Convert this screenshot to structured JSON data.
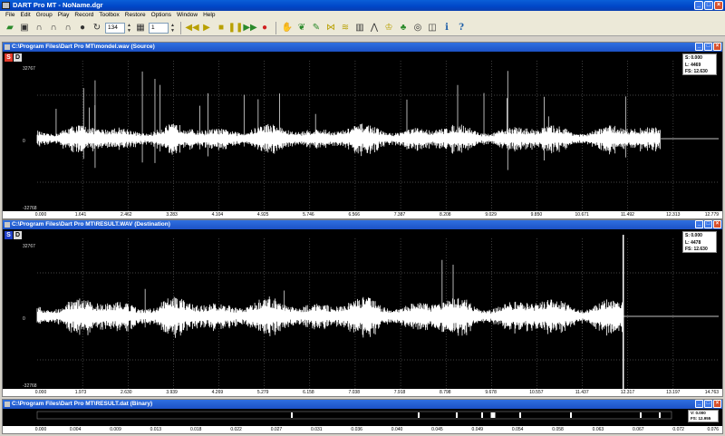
{
  "window": {
    "title": "DART Pro MT - NoName.dgr",
    "controls": [
      "_",
      "□",
      "×"
    ]
  },
  "menu": [
    "File",
    "Edit",
    "Group",
    "Play",
    "Record",
    "Toolbox",
    "Restore",
    "Options",
    "Window",
    "Help"
  ],
  "toolbar": {
    "spin1_value": "134",
    "spin2_value": "1"
  },
  "panels": [
    {
      "title": "C:\\Program Files\\Dart Pro MT\\mondel.wav (Source)",
      "buttons": [
        "S",
        "D"
      ],
      "y_top": "32767",
      "y_mid": "0",
      "y_bottom": "-32768",
      "info": [
        "S: 0.000",
        "L: 4469",
        "FS: 12.630"
      ],
      "x_ticks": [
        "0.000",
        "1.641",
        "2.462",
        "3.283",
        "4.104",
        "4.925",
        "5.746",
        "6.566",
        "7.387",
        "8.208",
        "9.029",
        "9.850",
        "10.671",
        "11.492",
        "12.313",
        "12.779"
      ],
      "clip_end": 0.915
    },
    {
      "title": "C:\\Program Files\\Dart Pro MT\\RESULT.WAV (Destination)",
      "buttons": [
        "S",
        "D"
      ],
      "y_top": "32767",
      "y_mid": "0",
      "y_bottom": "-32768",
      "info": [
        "S: 0.000",
        "L: 4478",
        "FS: 12.630"
      ],
      "x_ticks": [
        "0.000",
        "1.973",
        "2.630",
        "3.939",
        "4.269",
        "5.279",
        "6.158",
        "7.038",
        "7.918",
        "8.798",
        "9.678",
        "10.557",
        "11.437",
        "12.317",
        "13.197",
        "14.763"
      ],
      "clip_end": 0.86
    },
    {
      "title": "C:\\Program Files\\Dart Pro MT\\RESULT.dat (Binary)",
      "info": [
        "V: 0.000",
        "FS: 12.955"
      ],
      "x_ticks": [
        "0.000",
        "0.004",
        "0.009",
        "0.013",
        "0.018",
        "0.022",
        "0.027",
        "0.031",
        "0.036",
        "0.040",
        "0.045",
        "0.049",
        "0.054",
        "0.058",
        "0.063",
        "0.067",
        "0.072",
        "0.076"
      ]
    }
  ]
}
